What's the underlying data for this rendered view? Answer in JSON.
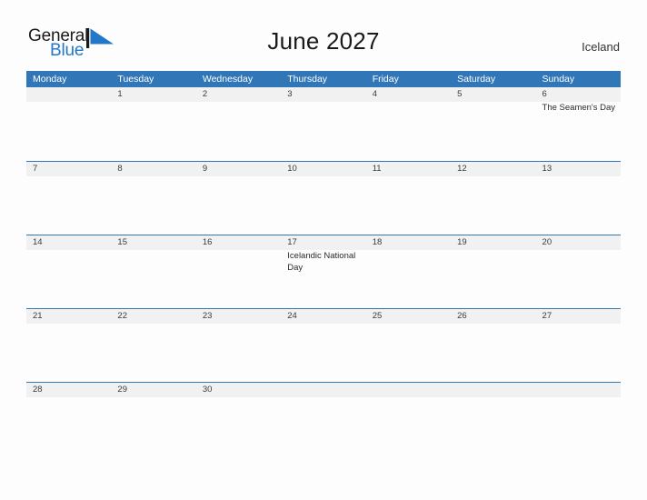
{
  "brand": {
    "name_part1": "General",
    "name_part2": "Blue",
    "flag_icon": "flag-icon",
    "accent_color": "#2277c8"
  },
  "header": {
    "title": "June 2027",
    "region": "Iceland"
  },
  "colors": {
    "header_blue": "#3177b8",
    "row_band_gray": "#f1f1f1",
    "page_background": "#fdfdfd",
    "text_dark": "#1a1a1a"
  },
  "calendar": {
    "weekdays": [
      "Monday",
      "Tuesday",
      "Wednesday",
      "Thursday",
      "Friday",
      "Saturday",
      "Sunday"
    ],
    "weeks": [
      [
        {
          "day": "",
          "events": []
        },
        {
          "day": "1",
          "events": []
        },
        {
          "day": "2",
          "events": []
        },
        {
          "day": "3",
          "events": []
        },
        {
          "day": "4",
          "events": []
        },
        {
          "day": "5",
          "events": []
        },
        {
          "day": "6",
          "events": [
            "The Seamen's Day"
          ]
        }
      ],
      [
        {
          "day": "7",
          "events": []
        },
        {
          "day": "8",
          "events": []
        },
        {
          "day": "9",
          "events": []
        },
        {
          "day": "10",
          "events": []
        },
        {
          "day": "11",
          "events": []
        },
        {
          "day": "12",
          "events": []
        },
        {
          "day": "13",
          "events": []
        }
      ],
      [
        {
          "day": "14",
          "events": []
        },
        {
          "day": "15",
          "events": []
        },
        {
          "day": "16",
          "events": []
        },
        {
          "day": "17",
          "events": [
            "Icelandic National Day"
          ]
        },
        {
          "day": "18",
          "events": []
        },
        {
          "day": "19",
          "events": []
        },
        {
          "day": "20",
          "events": []
        }
      ],
      [
        {
          "day": "21",
          "events": []
        },
        {
          "day": "22",
          "events": []
        },
        {
          "day": "23",
          "events": []
        },
        {
          "day": "24",
          "events": []
        },
        {
          "day": "25",
          "events": []
        },
        {
          "day": "26",
          "events": []
        },
        {
          "day": "27",
          "events": []
        }
      ],
      [
        {
          "day": "28",
          "events": []
        },
        {
          "day": "29",
          "events": []
        },
        {
          "day": "30",
          "events": []
        },
        {
          "day": "",
          "events": []
        },
        {
          "day": "",
          "events": []
        },
        {
          "day": "",
          "events": []
        },
        {
          "day": "",
          "events": []
        }
      ]
    ]
  }
}
